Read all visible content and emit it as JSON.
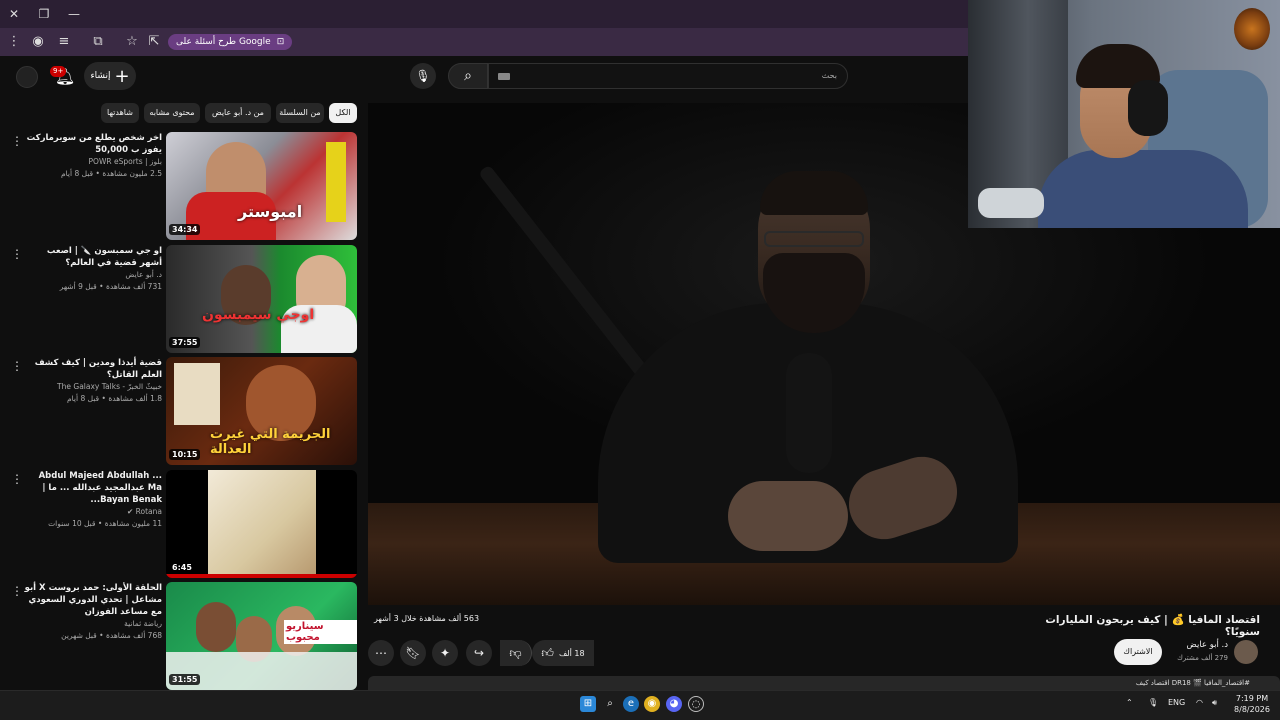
{
  "browser": {
    "close_glyph": "✕",
    "restore_glyph": "❐",
    "minimize_glyph": "—",
    "ask_google_chip": "طرح أسئلة على Google"
  },
  "header": {
    "create_label": "إنشاء",
    "notification_count": "9+",
    "search_placeholder": "بحث"
  },
  "chips": [
    "الكل",
    "من السلسلة",
    "من د. أبو عايض",
    "محتوى مشابه",
    "شاهدتها"
  ],
  "sidebar_videos": [
    {
      "title": "اخر شخص يطلع من سوبرماركت يفوز ب 50,000",
      "channel": "بلوز | POWR eSports",
      "meta": "2.5 مليون مشاهدة • قبل 8 أيام",
      "duration": "34:34",
      "thumb_caption": "امبوستر"
    },
    {
      "title": "او جي سمبسون 🔪 | اصعب أشهر قضية في العالم؟",
      "channel": "د. أبو عايض",
      "meta": "731 ألف مشاهدة • قبل 9 أشهر",
      "duration": "37:55",
      "thumb_caption": "اوجي سيمبسون"
    },
    {
      "title": "قضية أيدذا ومدين | كيف كشف العلم القاتل؟",
      "channel": "خبيثٌ الخبرّ - The Galaxy Talks",
      "meta": "1.8 ألف مشاهدة • قبل 8 أيام",
      "duration": "10:15",
      "thumb_caption": "الجريمة التي غيرت العدالة"
    },
    {
      "title": "Abdul Majeed Abdullah ... Ma عبدالمجيد عبدالله ... ما | Bayan Benak...",
      "channel": "Rotana",
      "meta": "11 مليون مشاهدة • قبل 10 سنوات",
      "duration": "6:45",
      "thumb_caption": ""
    },
    {
      "title": "الحلقة الأولى: حمد بروست X أبو مشاعل | تحدي الدوري السعودي مع مساعد الفوزان",
      "channel": "رياضة ثمانية",
      "meta": "768 ألف مشاهدة • قبل شهرين",
      "duration": "31:55",
      "thumb_caption": "سيناريو محبوب"
    }
  ],
  "video": {
    "title": "اقتصاد المافيا 💰 | كيف يربحون المليارات سنويًا؟",
    "views": "563 ألف مشاهدة  خلال 3 أشهر",
    "channel_name": "د. أبو عايض",
    "channel_subs": "279 ألف مشترك",
    "subscribe_label": "الاشتراك",
    "like_count": "18 ألف",
    "description_preview": "#اقتصاد_المافيا 🎬 DR18 اقتصاد كيف"
  },
  "taskbar": {
    "lang": "ENG",
    "time": "7:19 PM",
    "date": "8/8/2026"
  },
  "colors": {
    "background": "#0f0f0f",
    "chip": "#272727",
    "accent_red": "#cc0000",
    "browser_chrome": "#3a2a44"
  }
}
